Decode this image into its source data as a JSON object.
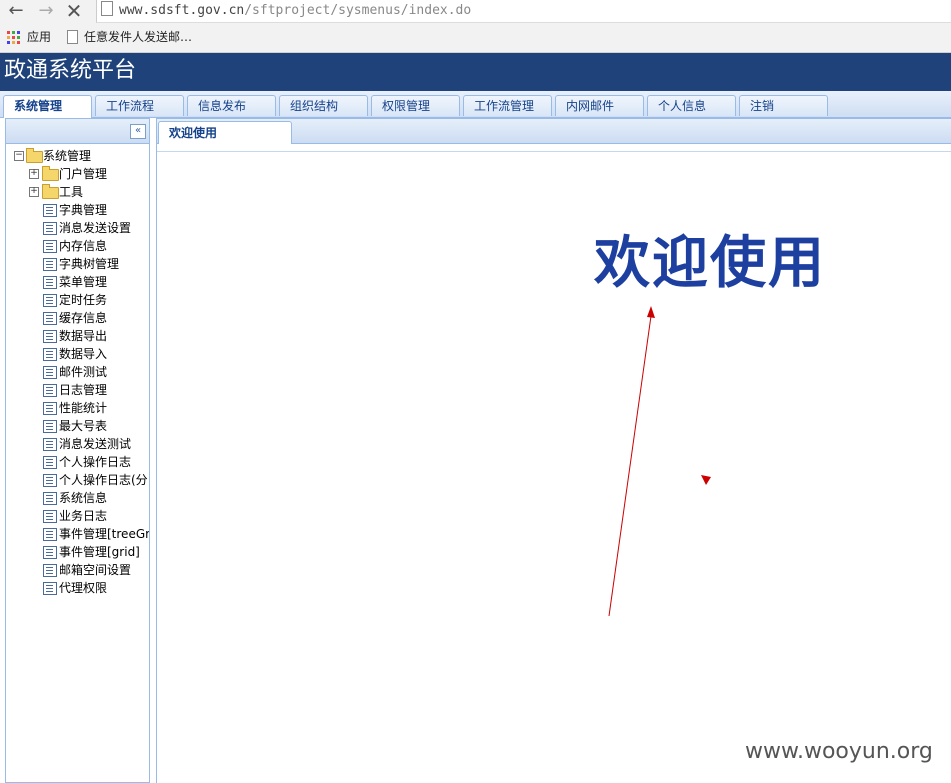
{
  "browser": {
    "url_host": "www.sdsft.gov.cn",
    "url_path": "/sftproject/sysmenus/index.do",
    "bookmarks": {
      "apps_label": "应用",
      "item_label": "任意发件人发送邮…"
    },
    "icons": {
      "back": "back-arrow-icon",
      "forward": "forward-arrow-icon",
      "stop": "stop-icon",
      "apps": "apps-grid-icon",
      "page": "page-icon"
    }
  },
  "header": {
    "title": "政通系统平台",
    "bg_color": "#1e4279"
  },
  "topnav": {
    "tabs": [
      {
        "label": "系统管理",
        "active": true
      },
      {
        "label": "工作流程",
        "active": false
      },
      {
        "label": "信息发布",
        "active": false
      },
      {
        "label": "组织结构",
        "active": false
      },
      {
        "label": "权限管理",
        "active": false
      },
      {
        "label": "工作流管理",
        "active": false
      },
      {
        "label": "内网邮件",
        "active": false
      },
      {
        "label": "个人信息",
        "active": false
      },
      {
        "label": "注销",
        "active": false
      }
    ]
  },
  "sidebar": {
    "collapse_icon": "double-chevron-left-icon",
    "tree": {
      "root": {
        "label": "系统管理",
        "expander": "⊟"
      },
      "folders": [
        {
          "label": "门户管理",
          "expander": "⊞"
        },
        {
          "label": "工具",
          "expander": "⊞"
        }
      ],
      "items": [
        "字典管理",
        "消息发送设置",
        "内存信息",
        "字典树管理",
        "菜单管理",
        "定时任务",
        "缓存信息",
        "数据导出",
        "数据导入",
        "邮件测试",
        "日志管理",
        "性能统计",
        "最大号表",
        "消息发送测试",
        "个人操作日志",
        "个人操作日志(分",
        "系统信息",
        "业务日志",
        "事件管理[treeGr",
        "事件管理[grid]",
        "邮箱空间设置",
        "代理权限"
      ]
    }
  },
  "main": {
    "tab_label": "欢迎使用",
    "welcome_text": "欢迎使用",
    "welcome_color": "#1c3fa0"
  },
  "annotation": {
    "arrow_color": "#cc0000"
  },
  "watermark": "www.wooyun.org"
}
